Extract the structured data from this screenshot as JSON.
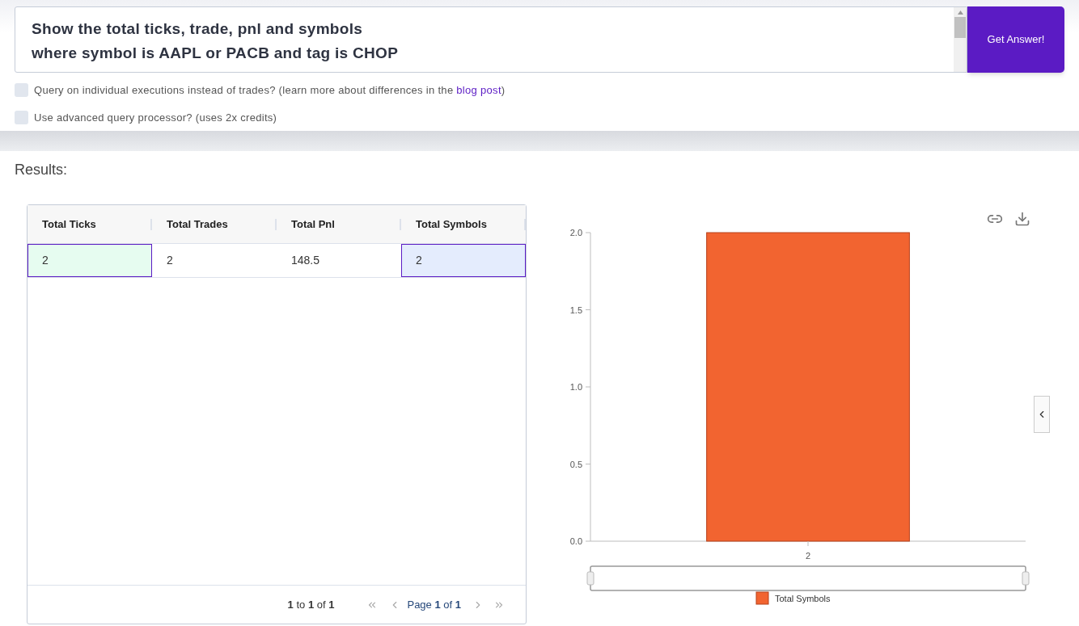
{
  "query": {
    "value": "Show the total ticks, trade, pnl and symbols\nwhere symbol is AAPL or PACB and tag is CHOP",
    "button": "Get Answer!"
  },
  "options": [
    {
      "text": "Query on individual executions instead of trades? (learn more about differences in the ",
      "link": "blog post",
      "after": ")",
      "checked": false
    },
    {
      "text": "Use advanced query processor? (uses 2x credits)",
      "checked": false
    }
  ],
  "results_label": "Results:",
  "table": {
    "columns": [
      "Total Ticks",
      "Total Trades",
      "Total Pnl",
      "Total Symbols"
    ],
    "rows": [
      {
        "cells": [
          {
            "text": "2",
            "selected": true,
            "color": "#e6fcf0"
          },
          {
            "text": "2",
            "selected": false
          },
          {
            "text": "148.5",
            "selected": false
          },
          {
            "text": "2",
            "selected": true,
            "color": "#e4ecfd"
          }
        ]
      }
    ],
    "pagination": {
      "summary": "**1** to **1** of **1**",
      "page": "Page **1** of **1**"
    }
  },
  "chart_data": {
    "type": "bar",
    "categories": [
      "2"
    ],
    "series": [
      {
        "name": "Total Symbols",
        "color": "#f26430",
        "values": [
          2
        ]
      }
    ],
    "ylim": [
      0,
      2
    ],
    "yticks": [
      {
        "value": 0,
        "label": "0.0"
      },
      {
        "value": 0.5,
        "label": "0.5"
      },
      {
        "value": 1,
        "label": "1.0"
      },
      {
        "value": 1.5,
        "label": "1.5"
      },
      {
        "value": 2,
        "label": "2.0"
      }
    ]
  }
}
